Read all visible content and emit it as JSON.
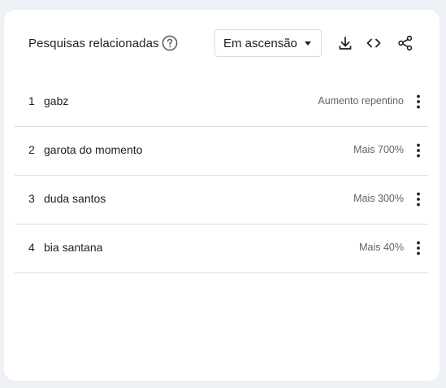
{
  "header": {
    "title": "Pesquisas relacionadas",
    "help_icon": "help-circle-icon",
    "sort_selected": "Em ascensão",
    "tools": [
      "download-icon",
      "embed-code-icon",
      "share-icon"
    ]
  },
  "rows": [
    {
      "rank": "1",
      "query": "gabz",
      "value": "Aumento repentino"
    },
    {
      "rank": "2",
      "query": "garota do momento",
      "value": "Mais 700%"
    },
    {
      "rank": "3",
      "query": "duda santos",
      "value": "Mais 300%"
    },
    {
      "rank": "4",
      "query": "bia santana",
      "value": "Mais 40%"
    }
  ],
  "colors": {
    "page_background": "#eef1f6",
    "card": "#ffffff",
    "text": "#202124",
    "secondary_text": "#5f6368",
    "divider": "#dadce0"
  }
}
